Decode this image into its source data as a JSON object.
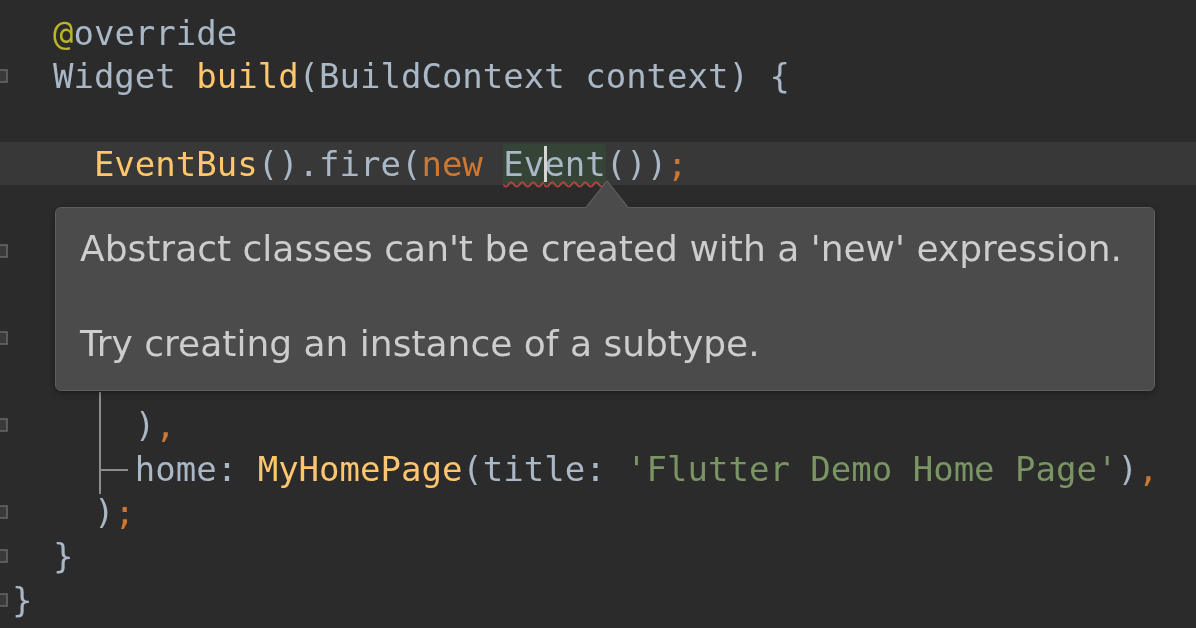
{
  "editor": {
    "lines": [
      {
        "tokens": [
          {
            "text": "  @",
            "kind": "annotation"
          },
          {
            "text": "override",
            "kind": "plain"
          }
        ],
        "fold": false,
        "current": false
      },
      {
        "tokens": [
          {
            "text": "  Widget ",
            "kind": "plain"
          },
          {
            "text": "build",
            "kind": "function"
          },
          {
            "text": "(BuildContext context) {",
            "kind": "plain"
          }
        ],
        "fold": true,
        "current": false
      },
      {
        "fold": false,
        "current": false
      },
      {
        "tokens": [
          {
            "text": "    EventBus",
            "kind": "function"
          },
          {
            "text": "().fire(",
            "kind": "plain"
          },
          {
            "text": "new ",
            "kind": "keyword"
          },
          {
            "text": "Ev",
            "kind": "plain",
            "error": true
          },
          {
            "text": "ent",
            "kind": "plain",
            "error": true,
            "caret": true
          },
          {
            "text": "())",
            "kind": "plain"
          },
          {
            "text": ";",
            "kind": "keyword"
          }
        ],
        "fold": false,
        "current": true
      },
      {
        "fold": false,
        "current": false
      },
      {
        "fold": true,
        "current": false
      },
      {
        "fold": false,
        "current": false
      },
      {
        "fold": true,
        "current": false
      },
      {
        "fold": false,
        "current": false
      },
      {
        "tokens": [
          {
            "text": "      )",
            "kind": "plain"
          },
          {
            "text": ",",
            "kind": "keyword"
          }
        ],
        "fold": true,
        "current": false
      },
      {
        "tokens": [
          {
            "text": "      home: ",
            "kind": "plain"
          },
          {
            "text": "MyHomePage",
            "kind": "function"
          },
          {
            "text": "(title: ",
            "kind": "plain"
          },
          {
            "text": "'Flutter Demo Home Page'",
            "kind": "string"
          },
          {
            "text": ")",
            "kind": "plain"
          },
          {
            "text": ",",
            "kind": "keyword"
          }
        ],
        "fold": false,
        "current": false
      },
      {
        "tokens": [
          {
            "text": "    )",
            "kind": "plain"
          },
          {
            "text": ";",
            "kind": "keyword"
          }
        ],
        "fold": true,
        "current": false
      },
      {
        "tokens": [
          {
            "text": "  }",
            "kind": "plain"
          }
        ],
        "fold": true,
        "current": false
      },
      {
        "tokens": [
          {
            "text": "}",
            "kind": "plain"
          }
        ],
        "fold": true,
        "current": false
      }
    ]
  },
  "tooltip": {
    "message": "Abstract classes can't be created with a 'new' expression.",
    "hint": "Try creating an instance of a subtype."
  }
}
